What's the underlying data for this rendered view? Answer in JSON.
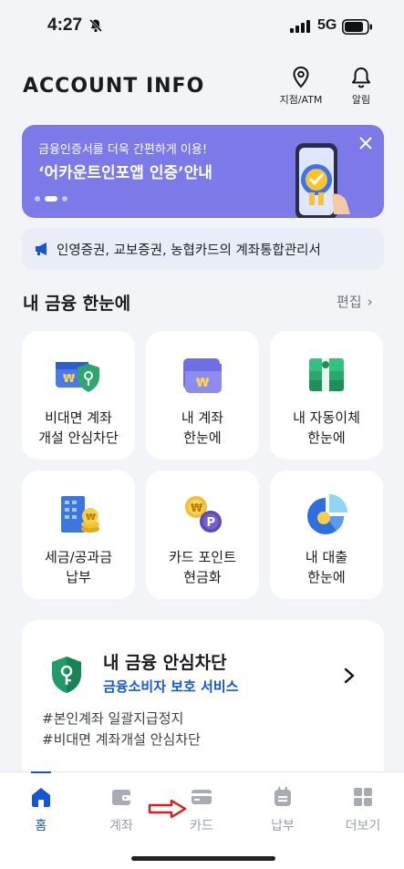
{
  "status": {
    "time": "4:27",
    "network": "5G"
  },
  "header": {
    "title": "ACCOUNT INFO",
    "branch_label": "지점/ATM",
    "alarm_label": "알림"
  },
  "banner": {
    "subtitle": "금융인증서를 더욱 간편하게 이용!",
    "title": "‘어카운트인포앱 인증’안내"
  },
  "notice": {
    "text": "인영증권, 교보증권, 농협카드의 계좌통합관리서"
  },
  "section": {
    "title": "내 금융 한눈에",
    "edit_label": "편집"
  },
  "tiles": [
    {
      "label": "비대면 계좌\n개설 안심차단",
      "icon": "shield-wallet-icon"
    },
    {
      "label": "내 계좌\n한눈에",
      "icon": "wallet-icon"
    },
    {
      "label": "내 자동이체\n한눈에",
      "icon": "money-stack-icon"
    },
    {
      "label": "세금/공과금\n납부",
      "icon": "building-coin-icon"
    },
    {
      "label": "카드 포인트\n현금화",
      "icon": "point-coin-icon"
    },
    {
      "label": "내 대출\n한눈에",
      "icon": "pie-chart-icon"
    }
  ],
  "protection": {
    "title": "내 금융 안심차단",
    "subtitle": "금융소비자 보호 서비스",
    "tags": [
      "#본인계좌 일괄지급정지",
      "#비대면 계좌개설 안심차단"
    ]
  },
  "bottom_nav": [
    {
      "label": "홈",
      "icon": "home-icon",
      "active": true
    },
    {
      "label": "계좌",
      "icon": "wallet-icon",
      "active": false
    },
    {
      "label": "카드",
      "icon": "card-icon",
      "active": false
    },
    {
      "label": "납부",
      "icon": "calendar-icon",
      "active": false
    },
    {
      "label": "더보기",
      "icon": "grid-icon",
      "active": false
    }
  ],
  "colors": {
    "accent": "#1457d6",
    "banner": "#7b7ae8",
    "annotation_arrow": "#e01a1a"
  }
}
